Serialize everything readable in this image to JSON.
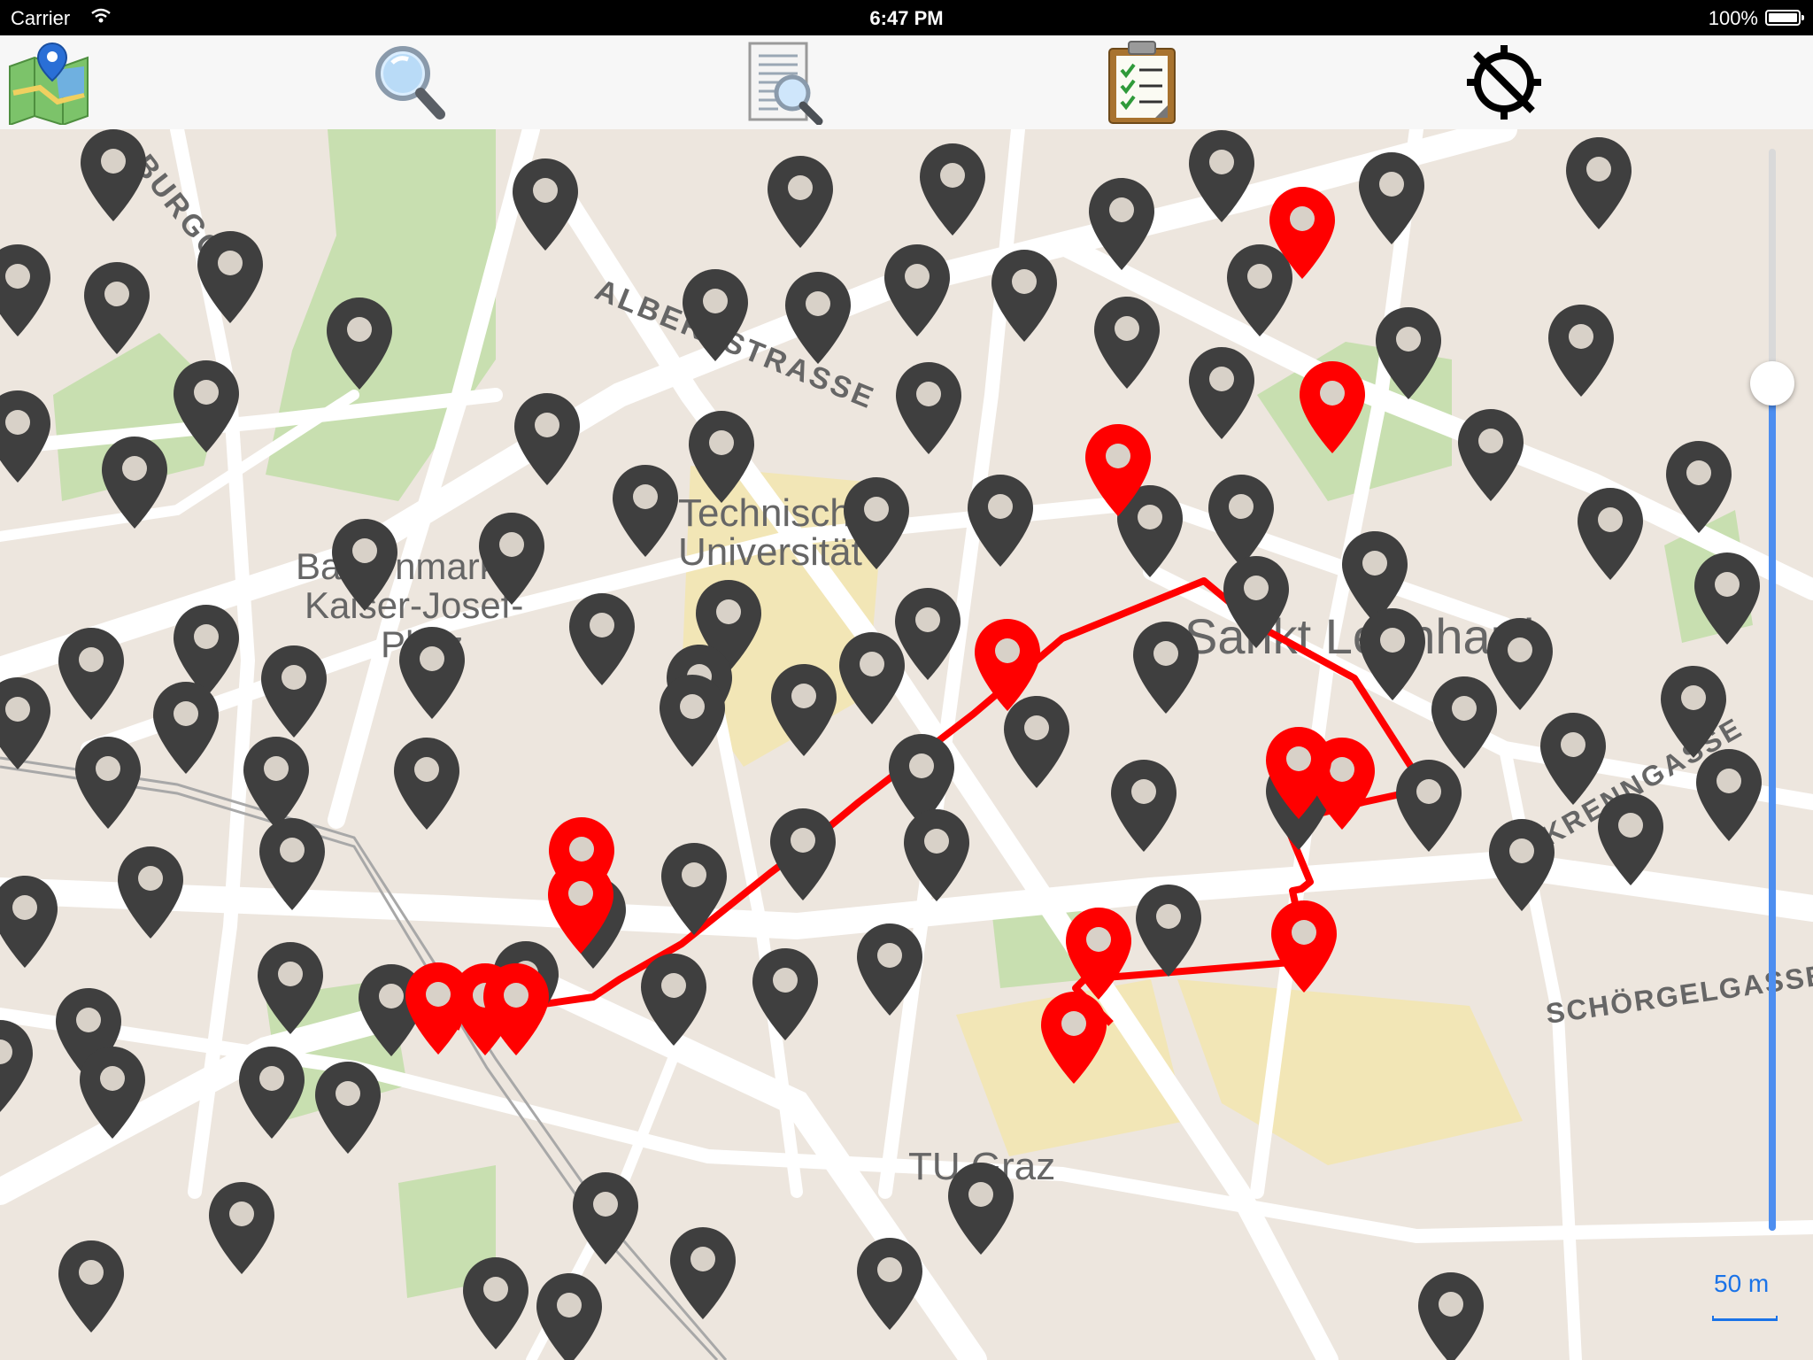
{
  "status_bar": {
    "carrier": "Carrier",
    "time": "6:47 PM",
    "battery": "100%"
  },
  "toolbar": {
    "items": [
      {
        "name": "map-icon"
      },
      {
        "name": "search-icon"
      },
      {
        "name": "document-search-icon"
      },
      {
        "name": "clipboard-checklist-icon"
      },
      {
        "name": "location-disabled-icon"
      }
    ]
  },
  "map": {
    "labels": {
      "albertstrasse": "ALBERTSTRASSE",
      "burggasse": "BURGG",
      "technische1": "Technische",
      "technische2": "Universität",
      "bauernmarkt1": "Bauernmarkt",
      "bauernmarkt2": "Kaiser-Josef-",
      "bauernmarkt3": "Platz",
      "sankt_leonhard": "Sankt Leonhard",
      "krenngasse": "KRENNGASSE",
      "schoergelgasse": "SCHÖRGELGASSE",
      "tu_graz": "TU Graz"
    },
    "scale": "50 m",
    "colors": {
      "marker_dark": "#3f3f3f",
      "marker_red": "#ff0000",
      "route": "#ff0000",
      "park": "#c8dfb0",
      "campus": "#f2e6b6",
      "road": "#ffffff"
    }
  }
}
